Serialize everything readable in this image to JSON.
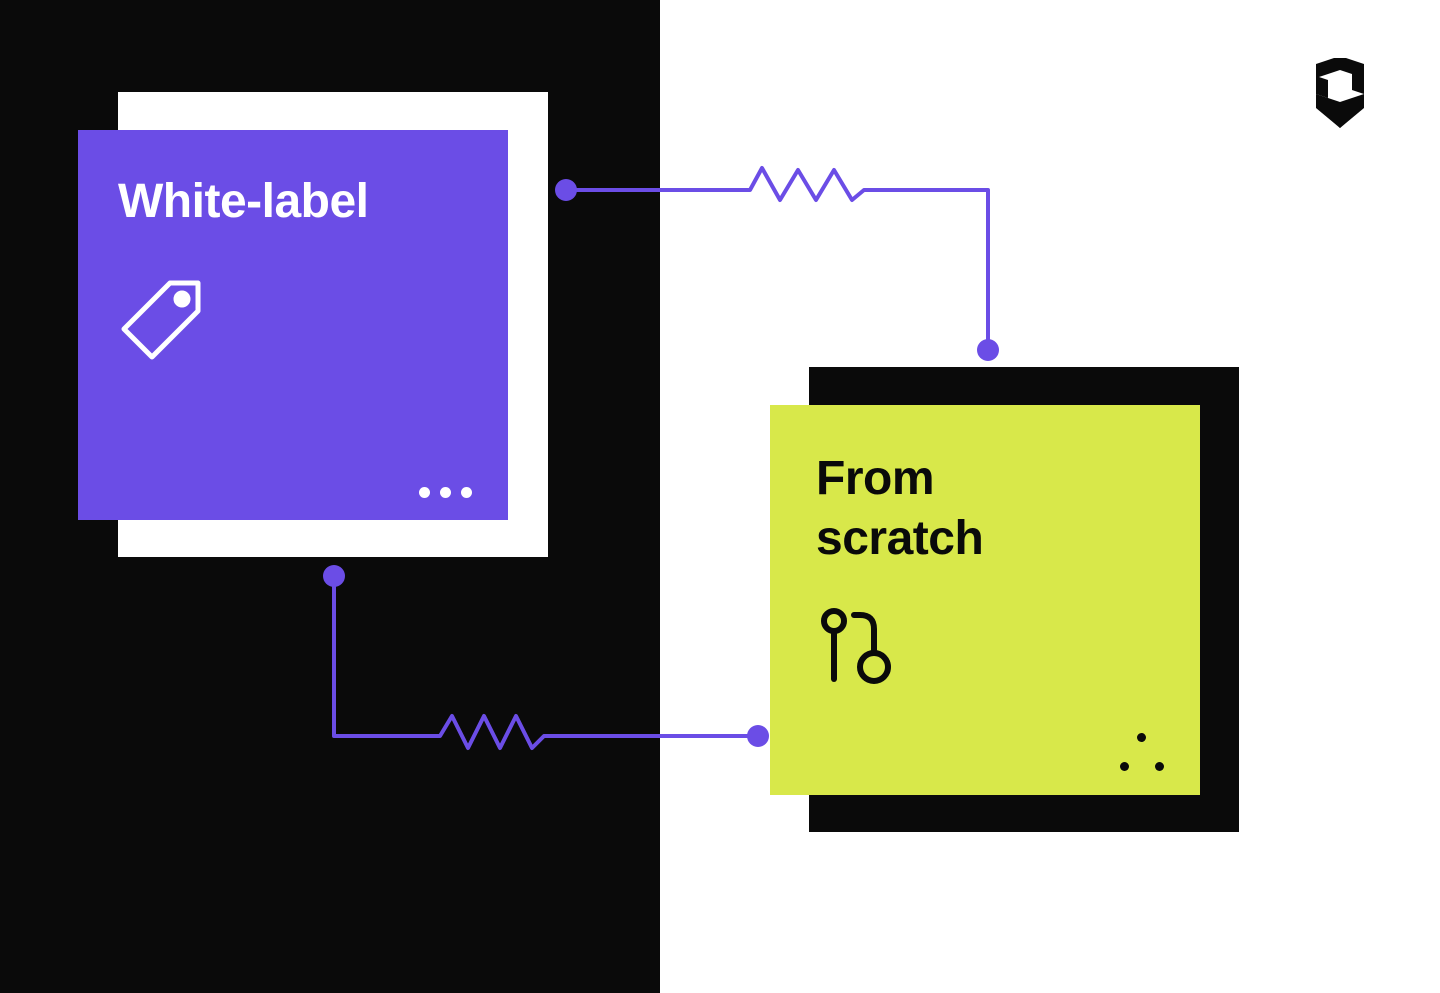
{
  "cards": {
    "left": {
      "title": "White-label",
      "icon_name": "tag-icon",
      "accent_color": "#6b4de6",
      "shadow_color": "#ffffff",
      "decoration": "horizontal-dots"
    },
    "right": {
      "title": "From scratch",
      "icon_name": "git-branch-icon",
      "accent_color": "#d8e84a",
      "shadow_color": "#0a0a0a",
      "decoration": "triangle-dots"
    }
  },
  "connectors": {
    "color": "#6b4de6",
    "style": "resistor-zigzag"
  },
  "background": {
    "left_color": "#0a0a0a",
    "right_color": "#ffffff"
  },
  "logo": {
    "name": "ms-monogram",
    "color": "#0a0a0a"
  }
}
